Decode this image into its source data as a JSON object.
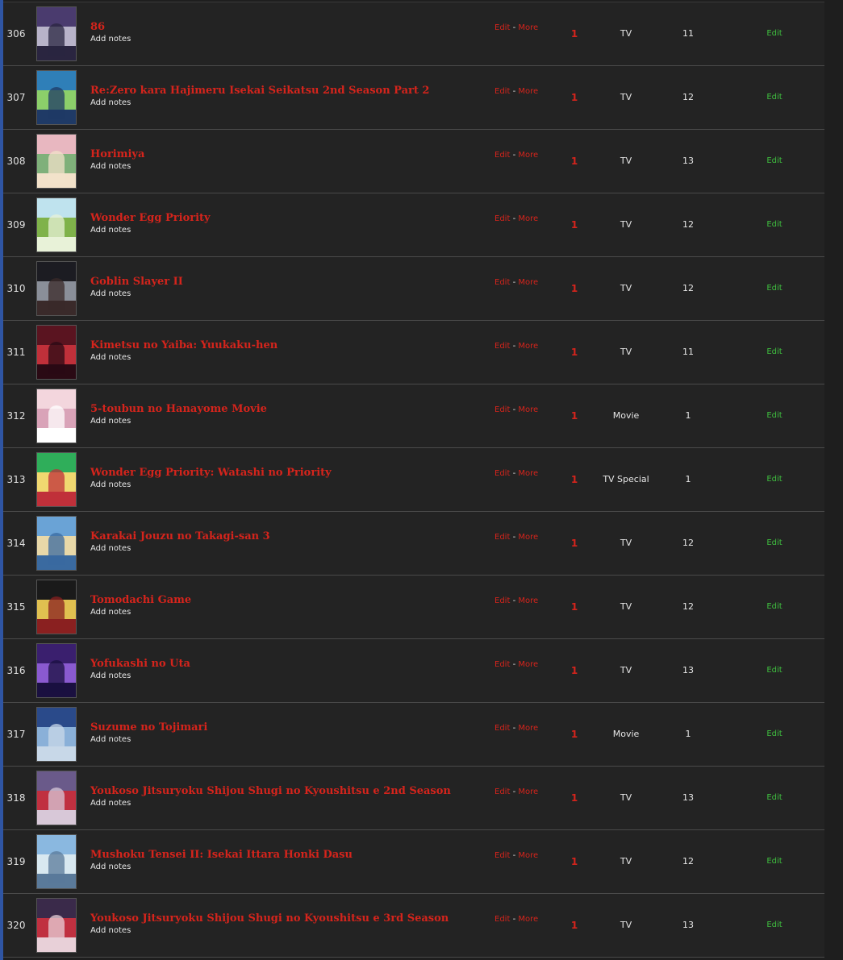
{
  "rows": [
    {
      "num": "306",
      "title": "86",
      "notes": "Add notes",
      "edit": "Edit",
      "sep": "-",
      "more": "More",
      "score": "1",
      "type": "TV",
      "episodes": "11",
      "progress_edit": "Edit",
      "colors": [
        "#4a3b6e",
        "#b8b3c9",
        "#2a2540"
      ]
    },
    {
      "num": "307",
      "title": "Re:Zero kara Hajimeru Isekai Seikatsu 2nd Season Part 2",
      "notes": "Add notes",
      "edit": "Edit",
      "sep": "-",
      "more": "More",
      "score": "1",
      "type": "TV",
      "episodes": "12",
      "progress_edit": "Edit",
      "colors": [
        "#2f7fb8",
        "#8ccf6a",
        "#1f3a66"
      ]
    },
    {
      "num": "308",
      "title": "Horimiya",
      "notes": "Add notes",
      "edit": "Edit",
      "sep": "-",
      "more": "More",
      "score": "1",
      "type": "TV",
      "episodes": "13",
      "progress_edit": "Edit",
      "colors": [
        "#e8b7c0",
        "#7fb07a",
        "#f2e1c9"
      ]
    },
    {
      "num": "309",
      "title": "Wonder Egg Priority",
      "notes": "Add notes",
      "edit": "Edit",
      "sep": "-",
      "more": "More",
      "score": "1",
      "type": "TV",
      "episodes": "12",
      "progress_edit": "Edit",
      "colors": [
        "#bfe3ee",
        "#7fb24a",
        "#e8f2d8"
      ]
    },
    {
      "num": "310",
      "title": "Goblin Slayer II",
      "notes": "Add notes",
      "edit": "Edit",
      "sep": "-",
      "more": "More",
      "score": "1",
      "type": "TV",
      "episodes": "12",
      "progress_edit": "Edit",
      "colors": [
        "#1c1c22",
        "#8a8f99",
        "#3a2a2a"
      ]
    },
    {
      "num": "311",
      "title": "Kimetsu no Yaiba: Yuukaku-hen",
      "notes": "Add notes",
      "edit": "Edit",
      "sep": "-",
      "more": "More",
      "score": "1",
      "type": "TV",
      "episodes": "11",
      "progress_edit": "Edit",
      "colors": [
        "#5a1420",
        "#c0303a",
        "#2a0a14"
      ]
    },
    {
      "num": "312",
      "title": "5-toubun no Hanayome Movie",
      "notes": "Add notes",
      "edit": "Edit",
      "sep": "-",
      "more": "More",
      "score": "1",
      "type": "Movie",
      "episodes": "1",
      "progress_edit": "Edit",
      "colors": [
        "#f3d6dd",
        "#d9a3b8",
        "#ffffff"
      ]
    },
    {
      "num": "313",
      "title": "Wonder Egg Priority: Watashi no Priority",
      "notes": "Add notes",
      "edit": "Edit",
      "sep": "-",
      "more": "More",
      "score": "1",
      "type": "TV Special",
      "episodes": "1",
      "progress_edit": "Edit",
      "colors": [
        "#2fae5a",
        "#f0d870",
        "#c0303a"
      ]
    },
    {
      "num": "314",
      "title": "Karakai Jouzu no Takagi-san 3",
      "notes": "Add notes",
      "edit": "Edit",
      "sep": "-",
      "more": "More",
      "score": "1",
      "type": "TV",
      "episodes": "12",
      "progress_edit": "Edit",
      "colors": [
        "#6aa3d6",
        "#e8d8a8",
        "#3a6aa0"
      ]
    },
    {
      "num": "315",
      "title": "Tomodachi Game",
      "notes": "Add notes",
      "edit": "Edit",
      "sep": "-",
      "more": "More",
      "score": "1",
      "type": "TV",
      "episodes": "12",
      "progress_edit": "Edit",
      "colors": [
        "#1a1a1a",
        "#e0c050",
        "#8a2020"
      ]
    },
    {
      "num": "316",
      "title": "Yofukashi no Uta",
      "notes": "Add notes",
      "edit": "Edit",
      "sep": "-",
      "more": "More",
      "score": "1",
      "type": "TV",
      "episodes": "13",
      "progress_edit": "Edit",
      "colors": [
        "#3a1f6e",
        "#8a5ad0",
        "#1a1040"
      ]
    },
    {
      "num": "317",
      "title": "Suzume no Tojimari",
      "notes": "Add notes",
      "edit": "Edit",
      "sep": "-",
      "more": "More",
      "score": "1",
      "type": "Movie",
      "episodes": "1",
      "progress_edit": "Edit",
      "colors": [
        "#2a4a8a",
        "#8ab0d8",
        "#c8d8e8"
      ]
    },
    {
      "num": "318",
      "title": "Youkoso Jitsuryoku Shijou Shugi no Kyoushitsu e 2nd Season",
      "notes": "Add notes",
      "edit": "Edit",
      "sep": "-",
      "more": "More",
      "score": "1",
      "type": "TV",
      "episodes": "13",
      "progress_edit": "Edit",
      "colors": [
        "#6a5a8a",
        "#c03040",
        "#d8c8d8"
      ]
    },
    {
      "num": "319",
      "title": "Mushoku Tensei II: Isekai Ittara Honki Dasu",
      "notes": "Add notes",
      "edit": "Edit",
      "sep": "-",
      "more": "More",
      "score": "1",
      "type": "TV",
      "episodes": "12",
      "progress_edit": "Edit",
      "colors": [
        "#8ab8e0",
        "#d8e8f0",
        "#5a7a9a"
      ]
    },
    {
      "num": "320",
      "title": "Youkoso Jitsuryoku Shijou Shugi no Kyoushitsu e 3rd Season",
      "notes": "Add notes",
      "edit": "Edit",
      "sep": "-",
      "more": "More",
      "score": "1",
      "type": "TV",
      "episodes": "13",
      "progress_edit": "Edit",
      "colors": [
        "#3a2a4a",
        "#c03040",
        "#e8d0d8"
      ]
    }
  ]
}
